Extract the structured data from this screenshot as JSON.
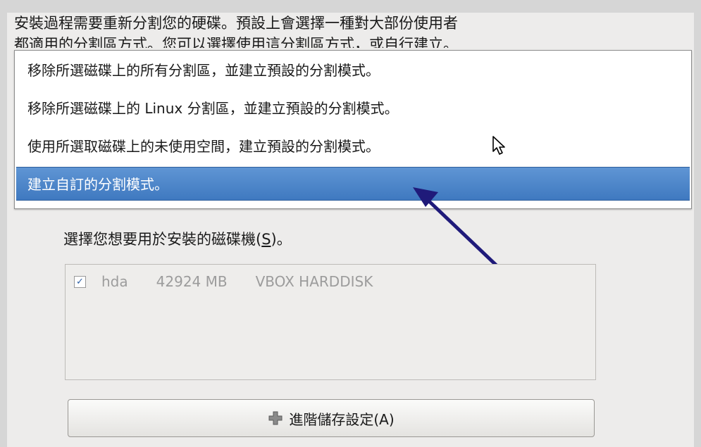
{
  "intro": {
    "line1": "安裝過程需要重新分割您的硬碟。預設上會選擇一種對大部份使用者",
    "line2": "都適用的分割區方式。您可以選擇使用這分割區方式，或自行建立。"
  },
  "partition_options": [
    {
      "label": "移除所選磁碟上的所有分割區，並建立預設的分割模式。",
      "selected": false
    },
    {
      "label": "移除所選磁碟上的 Linux 分割區，並建立預設的分割模式。",
      "selected": false
    },
    {
      "label": "使用所選取磁碟上的未使用空間，建立預設的分割模式。",
      "selected": false
    },
    {
      "label": "建立自訂的分割模式。",
      "selected": true
    }
  ],
  "disk_select": {
    "label_pre": "選擇您想要用於安裝的磁碟機(",
    "label_key": "S",
    "label_post": ")。",
    "disks": [
      {
        "checked": true,
        "name": "hda",
        "size": "42924 MB",
        "model": "VBOX HARDDISK"
      }
    ]
  },
  "advanced_button": {
    "label": "進階儲存設定(A)"
  },
  "colors": {
    "selection": "#3f79c0",
    "annotation_arrow": "#1f1a7a"
  },
  "icons": {
    "cursor": "mouse-pointer-icon",
    "advanced": "plus-icon",
    "check": "checkbox-checked-icon"
  }
}
